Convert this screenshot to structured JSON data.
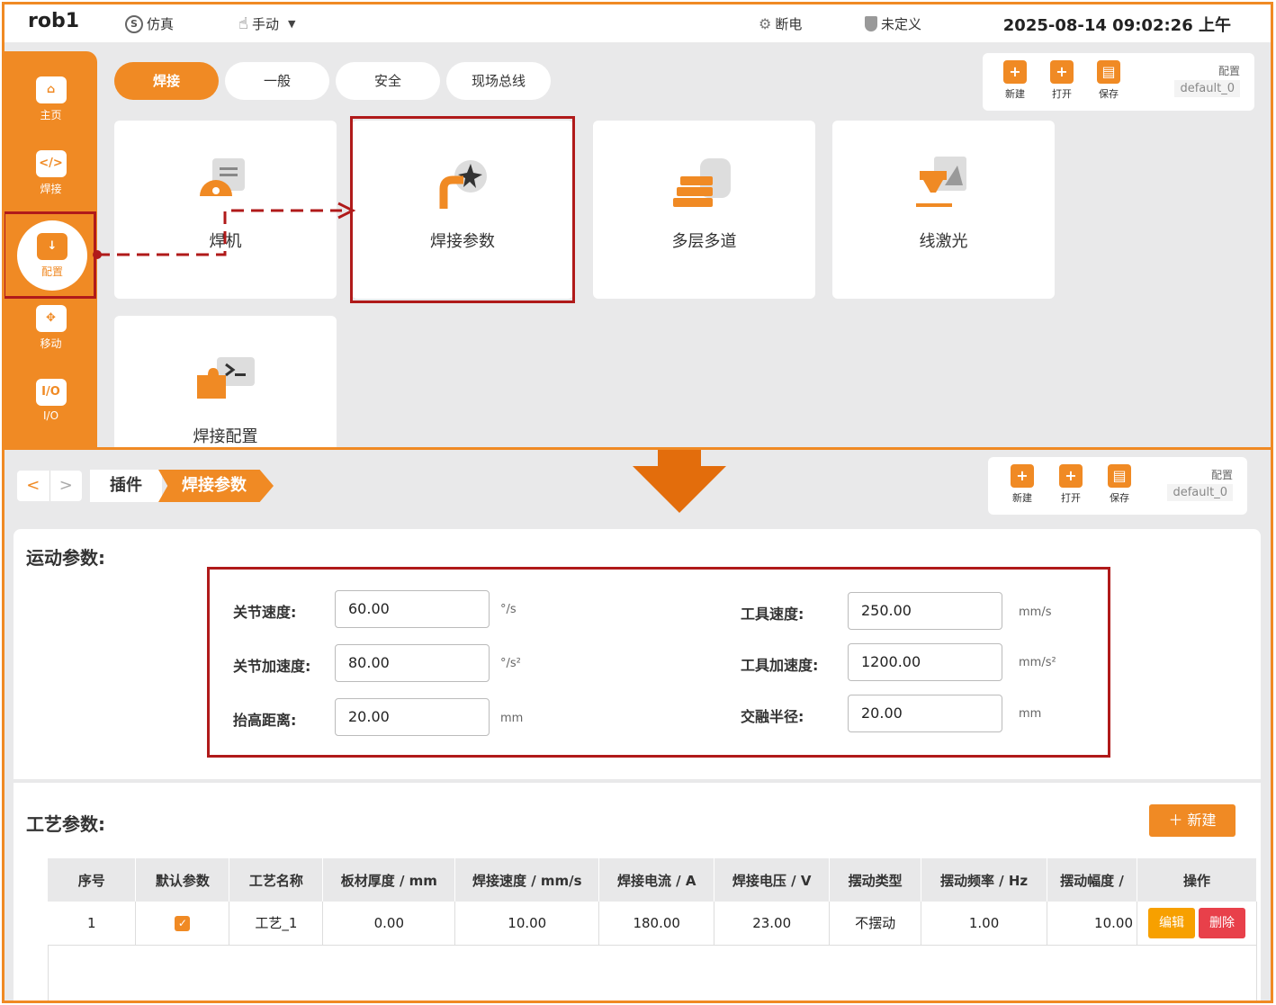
{
  "header": {
    "robot": "rob1",
    "mode": "仿真",
    "control": "手动",
    "power": "断电",
    "status": "未定义",
    "datetime": "2025-08-14 09:02:26 上午"
  },
  "sidebar": {
    "items": [
      {
        "icon": "home-icon",
        "label": "主页"
      },
      {
        "icon": "code-icon",
        "label": "焊接"
      },
      {
        "icon": "config-icon",
        "label": "配置"
      },
      {
        "icon": "move-icon",
        "label": "移动"
      },
      {
        "icon": "io-icon",
        "label": "I/O"
      }
    ]
  },
  "tabs": [
    {
      "label": "焊接",
      "active": true
    },
    {
      "label": "一般",
      "active": false
    },
    {
      "label": "安全",
      "active": false
    },
    {
      "label": "现场总线",
      "active": false
    }
  ],
  "toolbar": {
    "new": "新建",
    "open": "打开",
    "save": "保存",
    "config_label": "配置",
    "config_value": "default_0"
  },
  "plugins": [
    {
      "label": "焊机",
      "icon": "welder-icon"
    },
    {
      "label": "焊接参数",
      "icon": "weld-params-icon"
    },
    {
      "label": "多层多道",
      "icon": "multilayer-icon"
    },
    {
      "label": "线激光",
      "icon": "laser-icon"
    },
    {
      "label": "焊接配置",
      "icon": "weld-config-icon"
    }
  ],
  "breadcrumb": {
    "back": "<",
    "forward": ">",
    "parent": "插件",
    "current": "焊接参数"
  },
  "motion": {
    "title": "运动参数:",
    "joint_speed": {
      "label": "关节速度:",
      "value": "60.00",
      "unit": "°/s"
    },
    "joint_accel": {
      "label": "关节加速度:",
      "value": "80.00",
      "unit": "°/s²"
    },
    "lift_dist": {
      "label": "抬高距离:",
      "value": "20.00",
      "unit": "mm"
    },
    "tool_speed": {
      "label": "工具速度:",
      "value": "250.00",
      "unit": "mm/s"
    },
    "tool_accel": {
      "label": "工具加速度:",
      "value": "1200.00",
      "unit": "mm/s²"
    },
    "blend_radius": {
      "label": "交融半径:",
      "value": "20.00",
      "unit": "mm"
    }
  },
  "process": {
    "title": "工艺参数:",
    "new_button": "新建",
    "columns": [
      "序号",
      "默认参数",
      "工艺名称",
      "板材厚度 / mm",
      "焊接速度 / mm/s",
      "焊接电流 / A",
      "焊接电压 / V",
      "摆动类型",
      "摆动频率 / Hz",
      "摆动幅度 /",
      "操作"
    ],
    "rows": [
      {
        "index": "1",
        "default": "✓",
        "name": "工艺_1",
        "thickness": "0.00",
        "speed": "10.00",
        "current": "180.00",
        "voltage": "23.00",
        "swing_type": "不摆动",
        "swing_freq": "1.00",
        "swing_amp": "10.00",
        "edit": "编辑",
        "delete": "删除"
      }
    ]
  },
  "colors": {
    "accent": "#f08a24",
    "highlight": "#b01a1a",
    "delete": "#e8404a"
  }
}
